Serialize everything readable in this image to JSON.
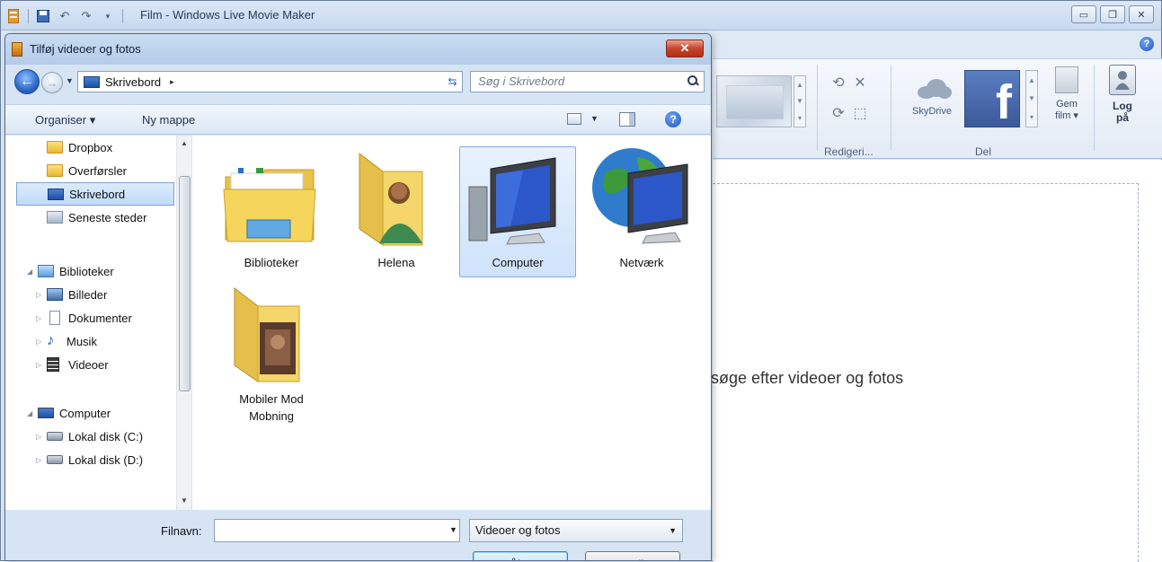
{
  "app": {
    "title": "Film - Windows Live Movie Maker",
    "window_controls": [
      "minimize",
      "restore",
      "close"
    ]
  },
  "ribbon": {
    "groups": [
      {
        "label": "Redigeri..."
      },
      {
        "label": "Del"
      }
    ],
    "skydrive_label": "SkyDrive",
    "gem_label_line1": "Gem",
    "gem_label_line2": "film ▾",
    "log_label_line1": "Log",
    "log_label_line2": "på"
  },
  "canvas": {
    "hint": "søge efter videoer og fotos"
  },
  "dialog": {
    "title": "Tilføj videoer og fotos",
    "close_label": "✕",
    "address": {
      "location": "Skrivebord",
      "separator": "▸"
    },
    "search_placeholder": "Søg i Skrivebord",
    "toolbar": {
      "organize_label": "Organiser ▾",
      "new_folder_label": "Ny mappe",
      "help_label": "?"
    },
    "nav": {
      "favorites": [
        {
          "label": "Dropbox",
          "icon": "dropbox-folder-icon"
        },
        {
          "label": "Overførsler",
          "icon": "downloads-folder-icon"
        },
        {
          "label": "Skrivebord",
          "icon": "desktop-icon",
          "selected": true
        },
        {
          "label": "Seneste steder",
          "icon": "recent-places-icon"
        }
      ],
      "libraries_label": "Biblioteker",
      "libraries": [
        {
          "label": "Billeder",
          "icon": "pictures-icon"
        },
        {
          "label": "Dokumenter",
          "icon": "documents-icon"
        },
        {
          "label": "Musik",
          "icon": "music-icon"
        },
        {
          "label": "Videoer",
          "icon": "videos-icon"
        }
      ],
      "computer_label": "Computer",
      "drives": [
        {
          "label": "Lokal disk (C:)",
          "icon": "drive-c-icon"
        },
        {
          "label": "Lokal disk (D:)",
          "icon": "drive-d-icon"
        }
      ]
    },
    "files": [
      {
        "label": "Biblioteker",
        "icon": "libraries-folder-icon"
      },
      {
        "label": "Helena",
        "icon": "user-folder-icon"
      },
      {
        "label": "Computer",
        "icon": "computer-icon",
        "selected": true
      },
      {
        "label": "Netværk",
        "icon": "network-icon"
      },
      {
        "label_line1": "Mobiler Mod",
        "label_line2": "Mobning",
        "icon": "photo-folder-icon"
      }
    ],
    "filename_label": "Filnavn:",
    "filename_value": "",
    "filetype_selected": "Videoer og fotos",
    "open_label": "Åbn",
    "cancel_label": "Annuller"
  },
  "colors": {
    "accent": "#1f57c4",
    "selection": "#cfe3fb",
    "dialog_bg": "#d6e4f4"
  }
}
